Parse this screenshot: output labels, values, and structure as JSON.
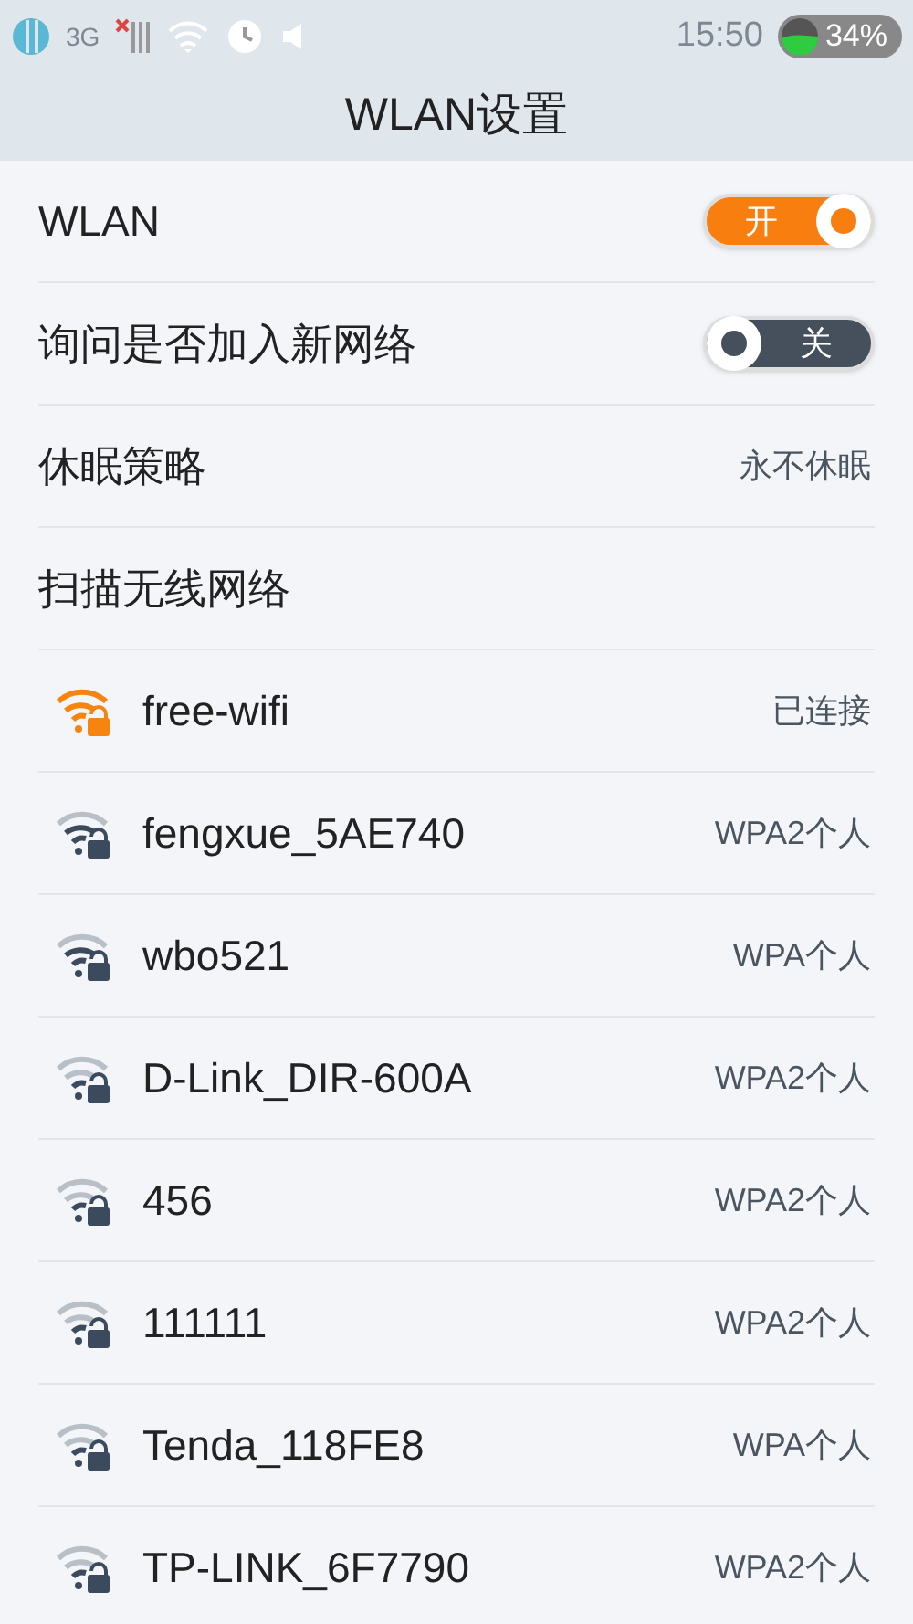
{
  "status_bar": {
    "network": "3G",
    "time": "15:50",
    "battery": "34%"
  },
  "title": "WLAN设置",
  "settings": [
    {
      "kind": "toggle",
      "label": "WLAN",
      "on": true,
      "text": "开"
    },
    {
      "kind": "toggle",
      "label": "询问是否加入新网络",
      "on": false,
      "text": "关"
    },
    {
      "kind": "value",
      "label": "休眠策略",
      "value": "永不休眠"
    },
    {
      "kind": "section",
      "label": "扫描无线网络"
    }
  ],
  "networks": [
    {
      "name": "free-wifi",
      "status": "已连接",
      "connected": true,
      "kind": "strong"
    },
    {
      "name": "fengxue_5AE740",
      "status": "WPA2个人",
      "connected": false,
      "kind": "strong"
    },
    {
      "name": "wbo521",
      "status": "WPA个人",
      "connected": false,
      "kind": "strong"
    },
    {
      "name": "D-Link_DIR-600A",
      "status": "WPA2个人",
      "connected": false,
      "kind": "medium"
    },
    {
      "name": "456",
      "status": "WPA2个人",
      "connected": false,
      "kind": "medium"
    },
    {
      "name": "111111",
      "status": "WPA2个人",
      "connected": false,
      "kind": "medium"
    },
    {
      "name": "Tenda_118FE8",
      "status": "WPA个人",
      "connected": false,
      "kind": "medium"
    },
    {
      "name": "TP-LINK_6F7790",
      "status": "WPA2个人",
      "connected": false,
      "kind": "medium"
    }
  ]
}
